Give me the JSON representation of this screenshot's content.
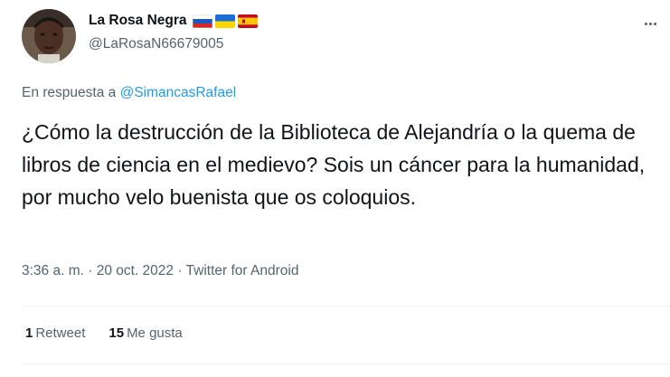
{
  "author": {
    "display_name": "La Rosa Negra",
    "handle": "@LaRosaN66679005",
    "flags": [
      "russia-flag",
      "ukraine-flag",
      "spain-flag"
    ]
  },
  "reply": {
    "prefix": "En respuesta a ",
    "mention": "@SimancasRafael"
  },
  "tweet": {
    "text": "¿Cómo la destrucción de la Biblioteca de Alejandría o la quema de libros de ciencia en el medievo? Sois un cáncer para la humanidad, por mucho velo buenista que os coloquios."
  },
  "meta": {
    "time": "3:36 a. m.",
    "separator1": " · ",
    "date": "20 oct. 2022",
    "separator2": " · ",
    "source": "Twitter for Android"
  },
  "stats": {
    "retweets_count": "1",
    "retweets_label": "Retweet",
    "likes_count": "15",
    "likes_label": "Me gusta"
  },
  "colors": {
    "link": "#1d9bf0",
    "secondary_text": "#536471",
    "primary_text": "#0f1419",
    "divider": "#eff3f4"
  }
}
